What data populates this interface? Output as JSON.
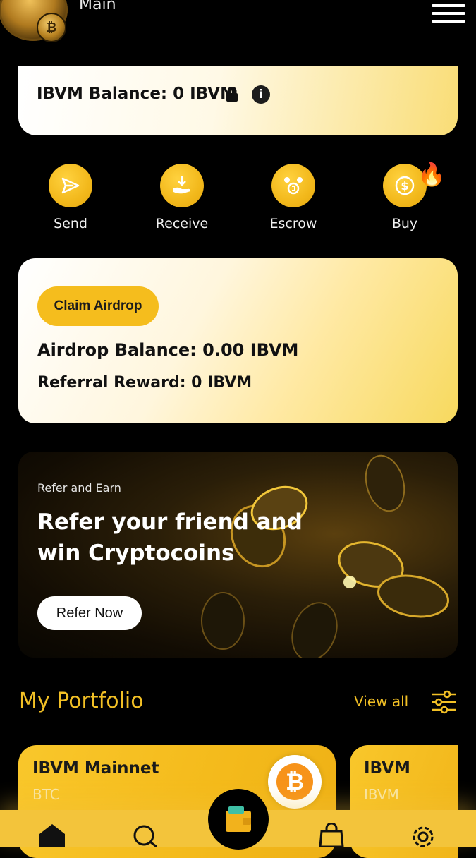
{
  "header": {
    "title": "Main",
    "logo_glyph": "₿"
  },
  "balance": {
    "text": "IBVM Balance: 0 IBVM",
    "info_glyph": "i"
  },
  "actions": [
    {
      "label": "Send",
      "icon": "send-icon"
    },
    {
      "label": "Receive",
      "icon": "receive-icon"
    },
    {
      "label": "Escrow",
      "icon": "escrow-icon"
    },
    {
      "label": "Buy",
      "icon": "buy-icon",
      "badge": "🔥"
    }
  ],
  "airdrop": {
    "claim_label": "Claim Airdrop",
    "airdrop_balance": "Airdrop Balance: 0.00 IBVM",
    "referral_reward": "Referral Reward: 0 IBVM"
  },
  "refer": {
    "small": "Refer and Earn",
    "headline": "Refer your friend and win Cryptocoins",
    "button": "Refer Now"
  },
  "portfolio": {
    "title": "My Portfolio",
    "view_all": "View all",
    "assets": [
      {
        "name": "IBVM Mainnet",
        "symbol": "BTC",
        "coin_glyph": "₿"
      },
      {
        "name": "IBVM",
        "symbol": "IBVM"
      }
    ]
  },
  "colors": {
    "accent": "#f2c025",
    "nav": "#f3c43b",
    "background": "#000000"
  }
}
